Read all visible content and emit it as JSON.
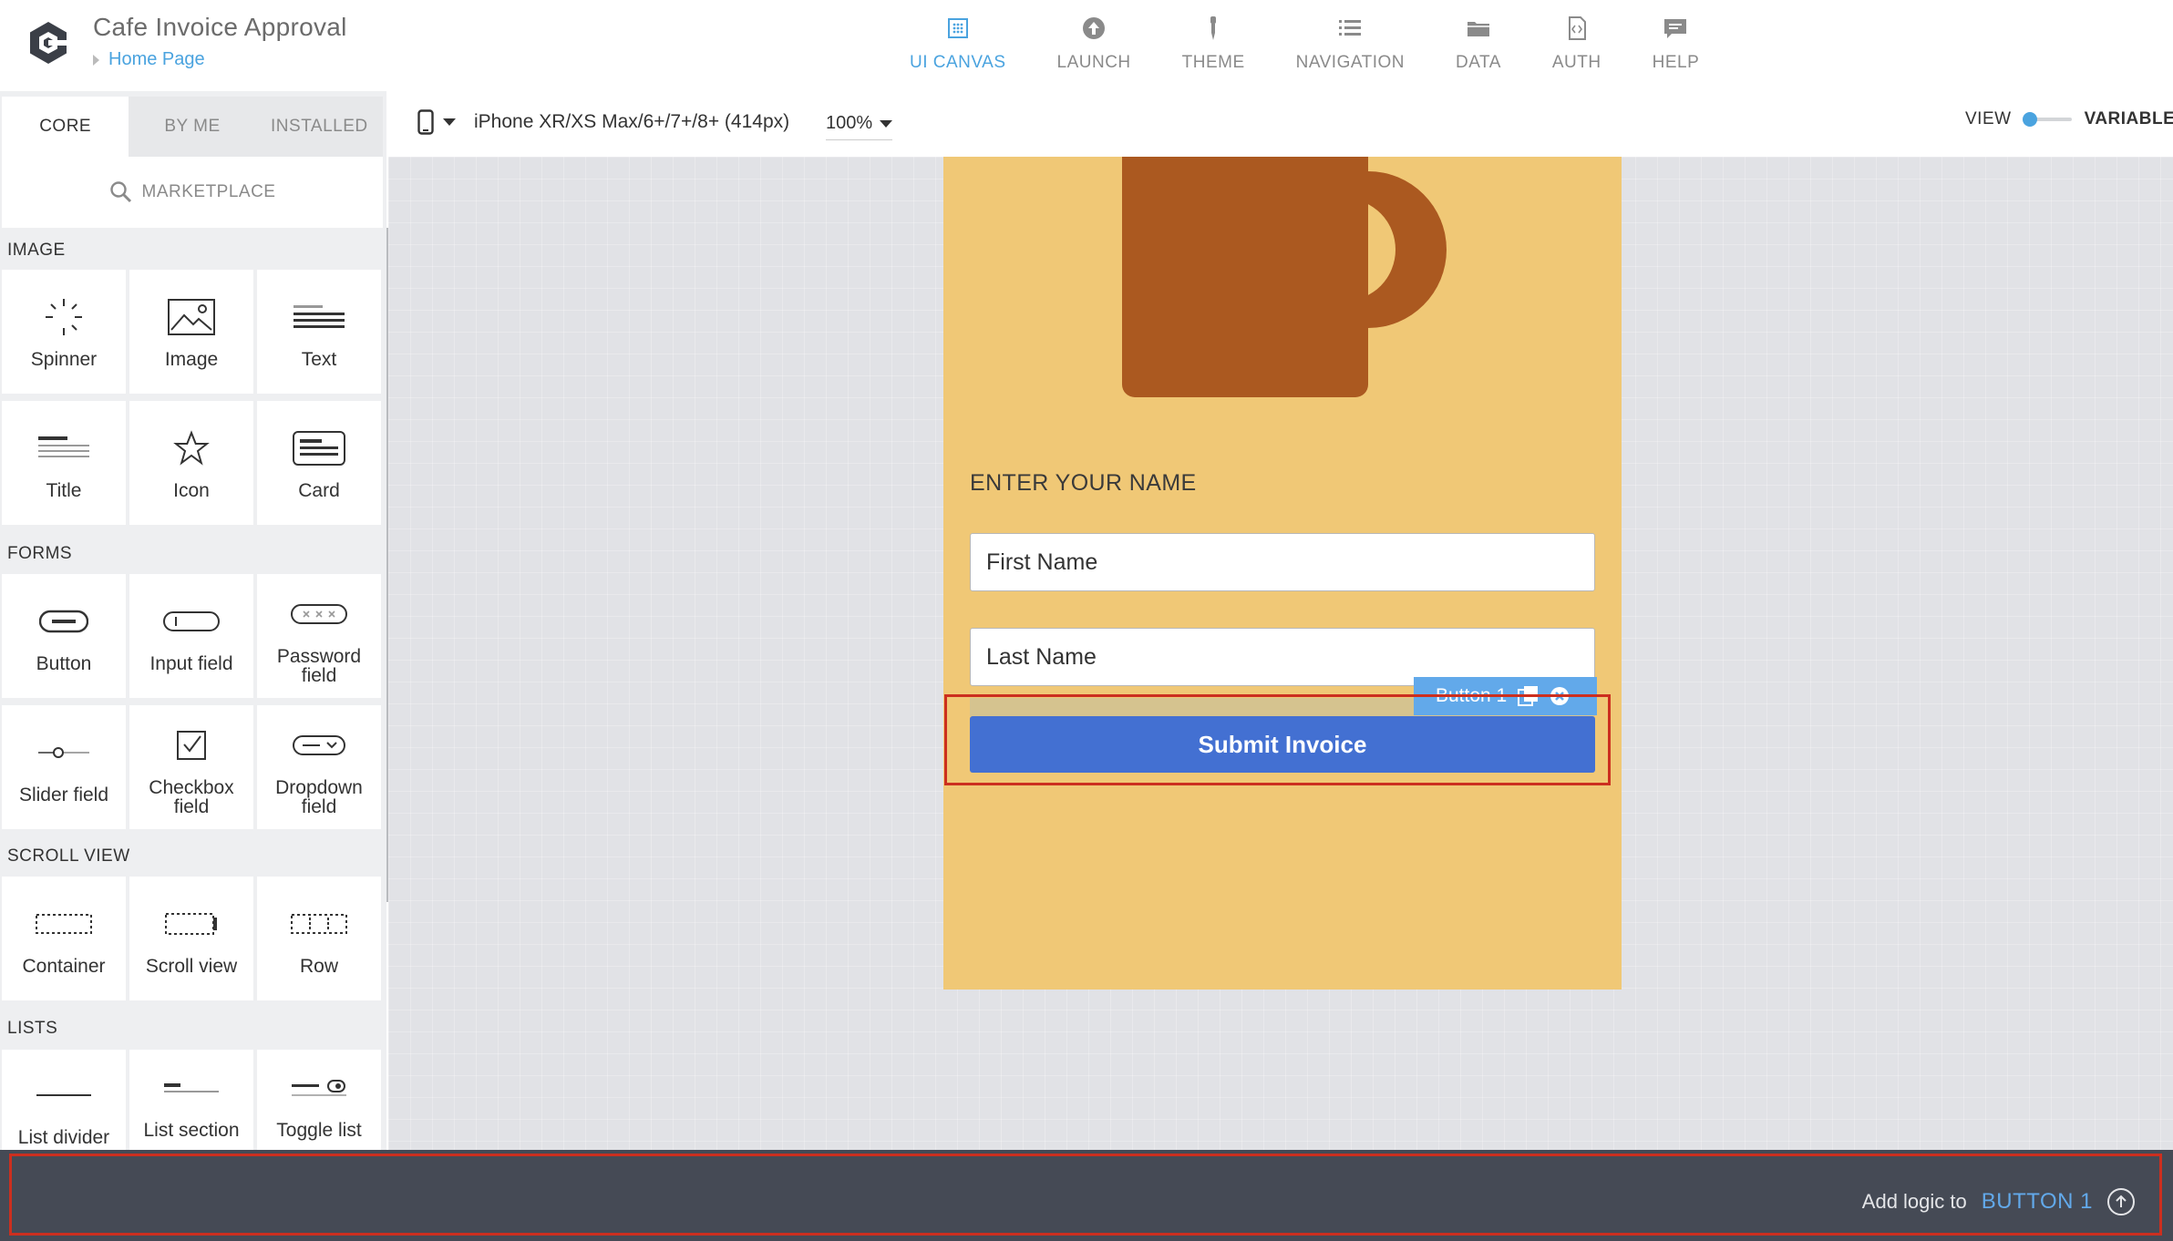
{
  "app": {
    "title": "Cafe Invoice Approval",
    "breadcrumb": "Home Page"
  },
  "topnav": [
    {
      "label": "UI CANVAS",
      "icon": "ui-canvas-icon",
      "active": true
    },
    {
      "label": "LAUNCH",
      "icon": "launch-icon"
    },
    {
      "label": "THEME",
      "icon": "theme-icon"
    },
    {
      "label": "NAVIGATION",
      "icon": "navigation-icon"
    },
    {
      "label": "DATA",
      "icon": "data-icon"
    },
    {
      "label": "AUTH",
      "icon": "auth-icon"
    },
    {
      "label": "HELP",
      "icon": "help-icon"
    }
  ],
  "panel": {
    "tabs": [
      "CORE",
      "BY ME",
      "INSTALLED"
    ],
    "active_tab": "CORE",
    "marketplace": "MARKETPLACE",
    "sections": {
      "image": "IMAGE",
      "forms": "FORMS",
      "scroll_view": "SCROLL VIEW",
      "lists": "LISTS"
    },
    "components": {
      "spinner": "Spinner",
      "image": "Image",
      "text": "Text",
      "title": "Title",
      "icon": "Icon",
      "card": "Card",
      "button": "Button",
      "input_field": "Input field",
      "password_field": "Password field",
      "slider_field": "Slider field",
      "checkbox_field": "Checkbox field",
      "dropdown_field": "Dropdown field",
      "container": "Container",
      "scroll_view": "Scroll view",
      "row": "Row",
      "list_divider": "List divider",
      "list_section": "List section",
      "toggle_list": "Toggle list"
    }
  },
  "toolbar": {
    "device": "iPhone XR/XS Max/6+/7+/8+ (414px)",
    "zoom": "100%",
    "view_label": "VIEW",
    "variables_label": "VARIABLES"
  },
  "screen": {
    "heading": "ENTER YOUR NAME",
    "first_name_placeholder": "First Name",
    "last_name_placeholder": "Last Name",
    "submit_label": "Submit Invoice",
    "selected_tag": "Button 1"
  },
  "bottom": {
    "add_logic_label": "Add logic to",
    "target": "BUTTON 1"
  },
  "colors": {
    "accent": "#4aa3df",
    "phone_bg": "#f0c876",
    "mug": "#ab5920",
    "submit_button": "#4370d2",
    "selection_outline": "#cc2f1f",
    "bottom_bar": "#454a55"
  }
}
